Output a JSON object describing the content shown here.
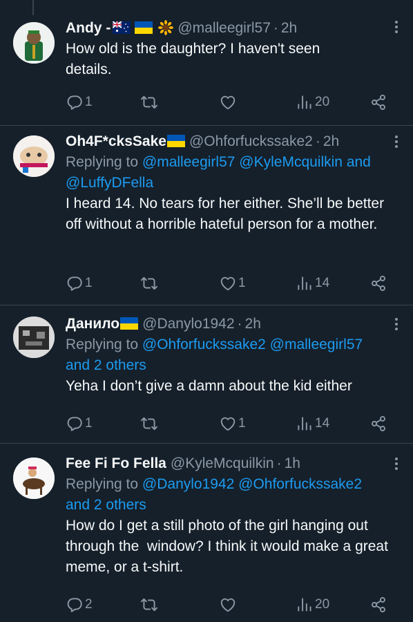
{
  "tweets": [
    {
      "name": "Andy - ",
      "flags": [
        "australia",
        "ukraine",
        "sunflower"
      ],
      "handle": "@malleegirl57",
      "time": "2h",
      "reply_prefix": "",
      "mentions_line1": "",
      "mentions_line2": "",
      "text": "How old is the daughter? I haven't seen details.",
      "replies": "1",
      "retweets": "",
      "likes": "",
      "views": "20"
    },
    {
      "name": "Oh4F*cksSake",
      "flags": [
        "ukraine"
      ],
      "handle": "@Ohforfuckssake2",
      "time": "2h",
      "reply_prefix": "Replying to ",
      "mentions_line1": "@malleegirl57 @KyleMcquilkin and",
      "mentions_line2": "@LuffyDFella",
      "text": "I heard 14. No tears for her either. She’ll be better off without a horrible hateful person for a mother.",
      "replies": "1",
      "retweets": "",
      "likes": "1",
      "views": "14"
    },
    {
      "name": "Данило",
      "flags": [
        "ukraine"
      ],
      "handle": "@Danylo1942",
      "time": "2h",
      "reply_prefix": "Replying to ",
      "mentions_line1": "@Ohforfuckssake2 @malleegirl57",
      "mentions_line2": "and 2 others",
      "text": "Yeha I don’t give a damn about the kid either",
      "replies": "1",
      "retweets": "",
      "likes": "1",
      "views": "14"
    },
    {
      "name": "Fee Fi Fo Fella",
      "flags": [],
      "handle": "@KyleMcquilkin",
      "time": "1h",
      "reply_prefix": "Replying to ",
      "mentions_line1": "@Danylo1942 @Ohforfuckssake2",
      "mentions_line2": "and 2 others",
      "text": "How do I get a still photo of the girl hanging out through the  window? I think it would make a great meme, or a t-shirt.",
      "replies": "2",
      "retweets": "",
      "likes": "",
      "views": "20"
    }
  ],
  "icons": {
    "reply": "reply-icon",
    "retweet": "retweet-icon",
    "like": "like-icon",
    "views": "views-icon",
    "share": "share-icon",
    "more": "more-icon"
  },
  "colors": {
    "background": "#15202b",
    "text": "#f7f9f9",
    "secondary": "#8b98a5",
    "link": "#1d9bf0",
    "divider": "#38444d"
  }
}
